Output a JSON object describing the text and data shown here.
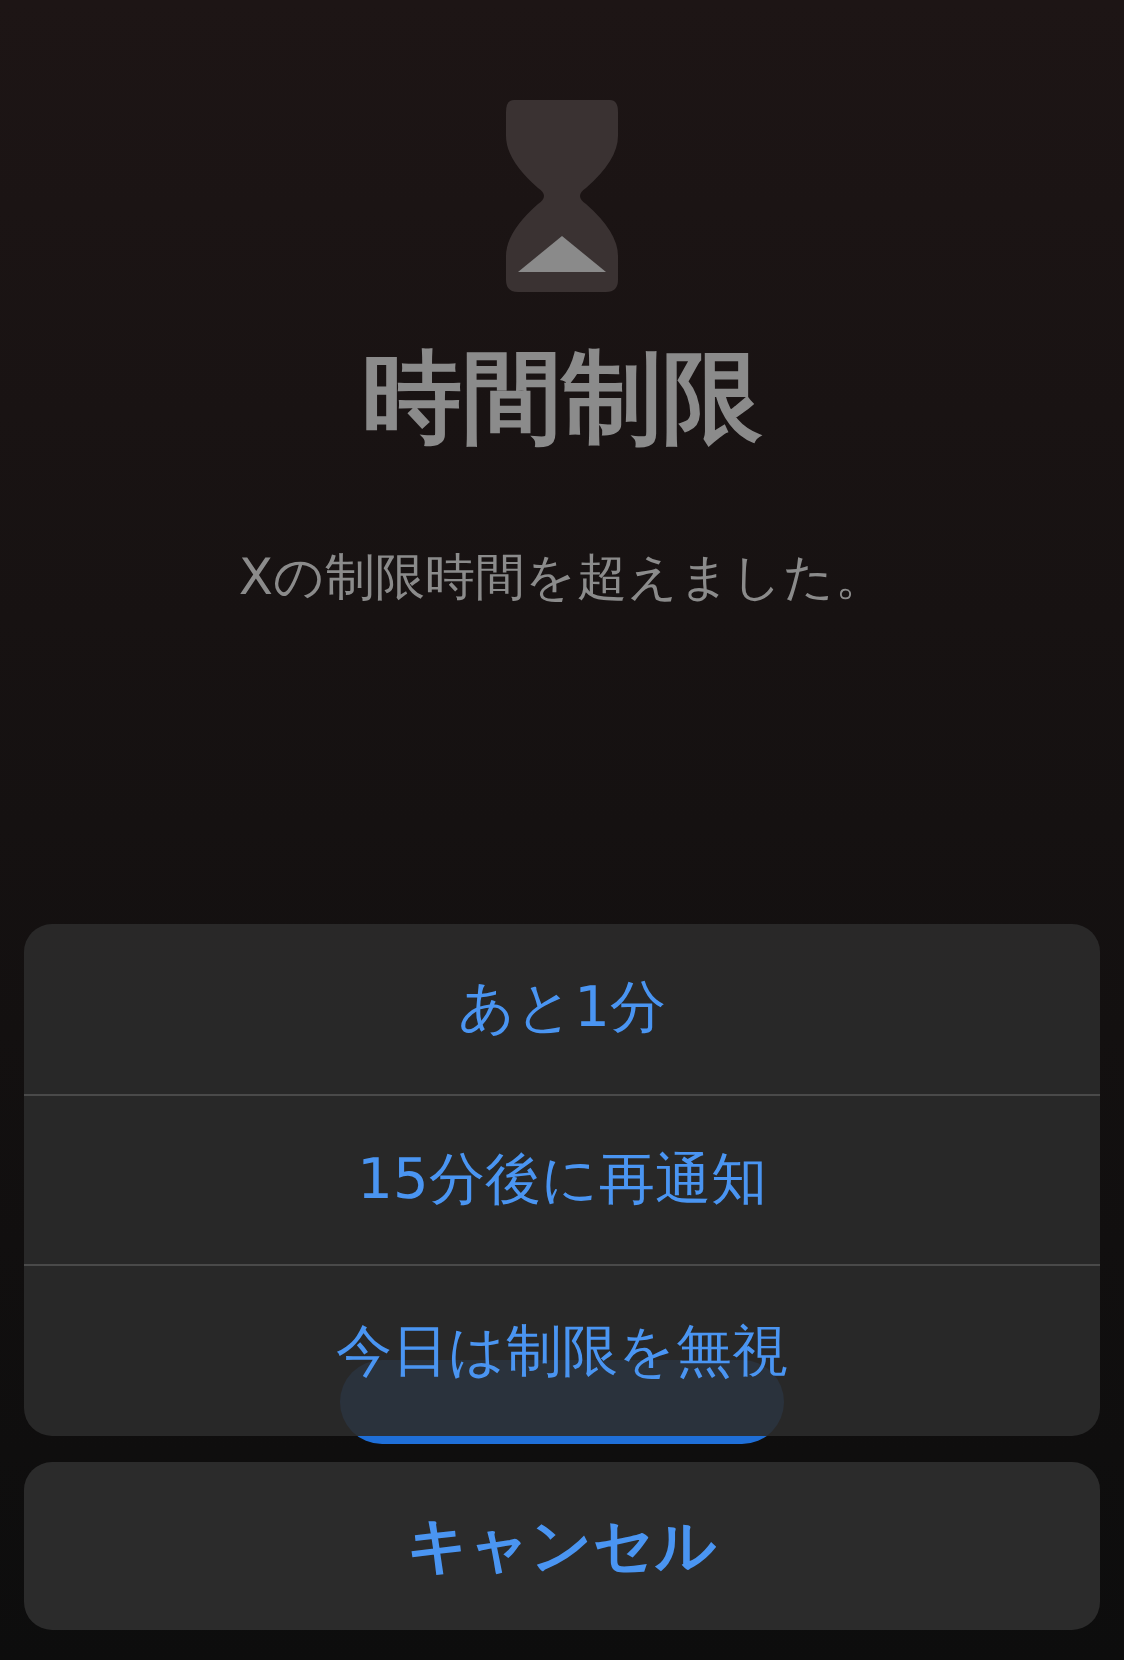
{
  "title": "時間制限",
  "message": "Xの制限時間を超えました。",
  "actions": [
    {
      "label": "あと1分"
    },
    {
      "label": "15分後に再通知"
    },
    {
      "label": "今日は制限を無視"
    }
  ],
  "cancel": "キャンセル"
}
